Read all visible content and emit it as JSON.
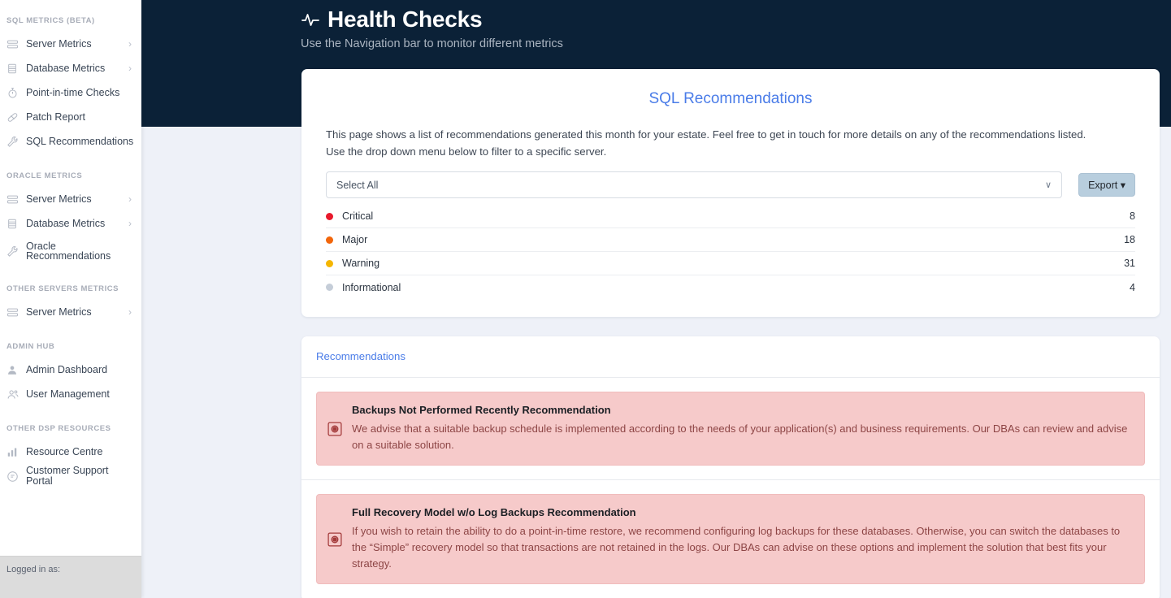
{
  "header": {
    "icon": "pulse-icon",
    "title": "Health Checks",
    "subtitle": "Use the Navigation bar to monitor different metrics",
    "bg_color": "#0b2137"
  },
  "sidebar": {
    "footer_text": "Logged in as:",
    "groups": [
      {
        "title": "SQL METRICS (BETA)",
        "items": [
          {
            "label": "Server Metrics",
            "icon": "server-icon",
            "chevron": "›"
          },
          {
            "label": "Database Metrics",
            "icon": "database-icon",
            "chevron": "›"
          },
          {
            "label": "Point-in-time Checks",
            "icon": "stopwatch-icon",
            "chevron": ""
          },
          {
            "label": "Patch Report",
            "icon": "bandage-icon",
            "chevron": ""
          },
          {
            "label": "SQL Recommendations",
            "icon": "wrench-icon",
            "chevron": ""
          }
        ]
      },
      {
        "title": "ORACLE METRICS",
        "items": [
          {
            "label": "Server Metrics",
            "icon": "server-icon",
            "chevron": "›"
          },
          {
            "label": "Database Metrics",
            "icon": "database-icon",
            "chevron": "›"
          },
          {
            "label": "Oracle Recommendations",
            "icon": "wrench-icon",
            "chevron": ""
          }
        ]
      },
      {
        "title": "OTHER SERVERS METRICS",
        "items": [
          {
            "label": "Server Metrics",
            "icon": "server-icon",
            "chevron": "›"
          }
        ]
      },
      {
        "title": "ADMIN HUB",
        "items": [
          {
            "label": "Admin Dashboard",
            "icon": "user-icon",
            "chevron": ""
          },
          {
            "label": "User Management",
            "icon": "users-icon",
            "chevron": ""
          }
        ]
      },
      {
        "title": "OTHER DSP RESOURCES",
        "items": [
          {
            "label": "Resource Centre",
            "icon": "bar-chart-icon",
            "chevron": ""
          },
          {
            "label": "Customer Support Portal",
            "icon": "chat-icon",
            "chevron": ""
          }
        ]
      }
    ]
  },
  "summary_card": {
    "heading": "SQL Recommendations",
    "description_line1": "This page shows a list of recommendations generated this month for your estate. Feel free to get in touch for more details on any of the recommendations listed.",
    "description_line2": "Use the drop down menu below to filter to a specific server.",
    "select": {
      "value": "Select All",
      "placeholder": "Select All",
      "caret": "∨"
    },
    "export_label": "Export",
    "export_caret": "▾",
    "severities": [
      {
        "label": "Critical",
        "count": "8",
        "color": "#e8192c"
      },
      {
        "label": "Major",
        "count": "18",
        "color": "#f2660b"
      },
      {
        "label": "Warning",
        "count": "31",
        "color": "#f5b600"
      },
      {
        "label": "Informational",
        "count": "4",
        "color": "#c5cdd8"
      }
    ]
  },
  "recommendations_card": {
    "tab_label": "Recommendations",
    "items": [
      {
        "title": "Backups Not Performed Recently Recommendation",
        "text": "We advise that a suitable backup schedule is implemented according to the needs of your application(s) and business requirements. Our DBAs can review and advise on a suitable solution.",
        "icon": "severity-critical-icon",
        "bg_color": "#f6caca"
      },
      {
        "title": "Full Recovery Model w/o Log Backups Recommendation",
        "text": "If you wish to retain the ability to do a point-in-time restore, we recommend configuring log backups for these databases. Otherwise, you can switch the databases to the “Simple” recovery model so that transactions are not retained in the logs. Our DBAs can advise on these options and implement the solution that best fits your strategy.",
        "icon": "severity-critical-icon",
        "bg_color": "#f6caca"
      }
    ]
  }
}
